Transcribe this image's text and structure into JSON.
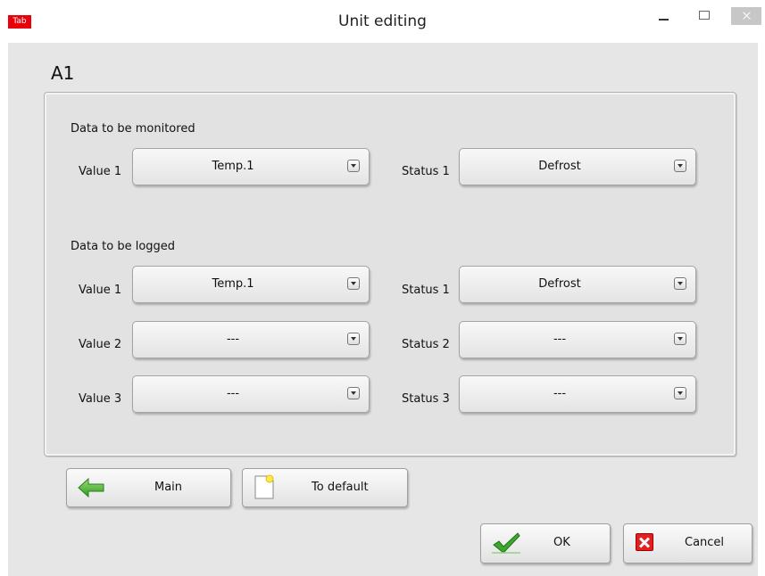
{
  "window": {
    "app_icon_label": "Tab",
    "title": "Unit editing"
  },
  "unit": {
    "name": "A1"
  },
  "monitored": {
    "section_label": "Data to be monitored",
    "value1": {
      "label": "Value 1",
      "selected": "Temp.1"
    },
    "status1": {
      "label": "Status 1",
      "selected": "Defrost"
    }
  },
  "logged": {
    "section_label": "Data to be logged",
    "value1": {
      "label": "Value 1",
      "selected": "Temp.1"
    },
    "value2": {
      "label": "Value 2",
      "selected": "---"
    },
    "value3": {
      "label": "Value 3",
      "selected": "---"
    },
    "status1": {
      "label": "Status 1",
      "selected": "Defrost"
    },
    "status2": {
      "label": "Status 2",
      "selected": "---"
    },
    "status3": {
      "label": "Status 3",
      "selected": "---"
    }
  },
  "buttons": {
    "main": "Main",
    "to_default": "To default",
    "ok": "OK",
    "cancel": "Cancel"
  },
  "colors": {
    "app_icon": "#e8000b",
    "background": "#e6e6e6",
    "cancel_icon": "#e41f1f",
    "ok_check": "#3aa82c",
    "main_arrow": "#4caf32"
  }
}
